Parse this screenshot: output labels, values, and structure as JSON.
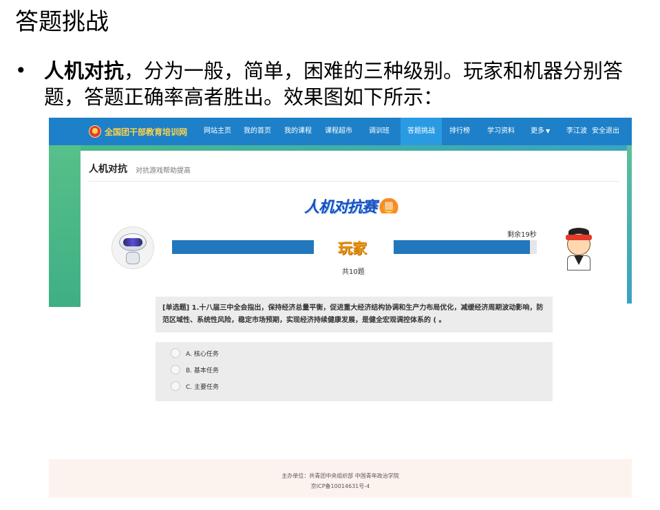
{
  "slide": {
    "title": "答题挑战",
    "bullet": {
      "bold": "人机对抗",
      "rest": "，分为一般，简单，困难的三种级别。玩家和机器分别答题，答题正确率高者胜出。效果图如下所示："
    }
  },
  "site": {
    "logo_text": "全国团干部教育培训网",
    "nav": [
      "网站主页",
      "我的首页",
      "我的课程",
      "课程超市",
      "调训班",
      "答题挑战",
      "排行榜",
      "学习资料",
      "更多",
      "李江波",
      "安全退出"
    ],
    "active_nav": "答题挑战",
    "colors": {
      "nav_bg": "#1d80c8",
      "active_nav": "#2a9be3",
      "progress": "#2277bd"
    }
  },
  "page": {
    "title": "人机对抗",
    "subtitle": "对抗游戏帮助提高",
    "banner": "人机对抗赛",
    "timer": "剩余19秒",
    "player_label": "玩家",
    "total": "共10题",
    "machine_progress": 1.0,
    "player_progress": 0.95
  },
  "question": {
    "text": "[单选题] 1.十八届三中全会指出，保持经济总量平衡，促进重大经济结构协调和生产力布局优化，减缓经济周期波动影响，防范区域性、系统性风险，稳定市场预期，实现经济持续健康发展，是健全宏观调控体系的 ( 。",
    "options": [
      "A. 核心任务",
      "B. 基本任务",
      "C. 主要任务"
    ]
  },
  "footer": {
    "line1": "主办单位：共青团中央组织部 中国青年政治学院",
    "line2": "京ICP备10014631号-4"
  }
}
